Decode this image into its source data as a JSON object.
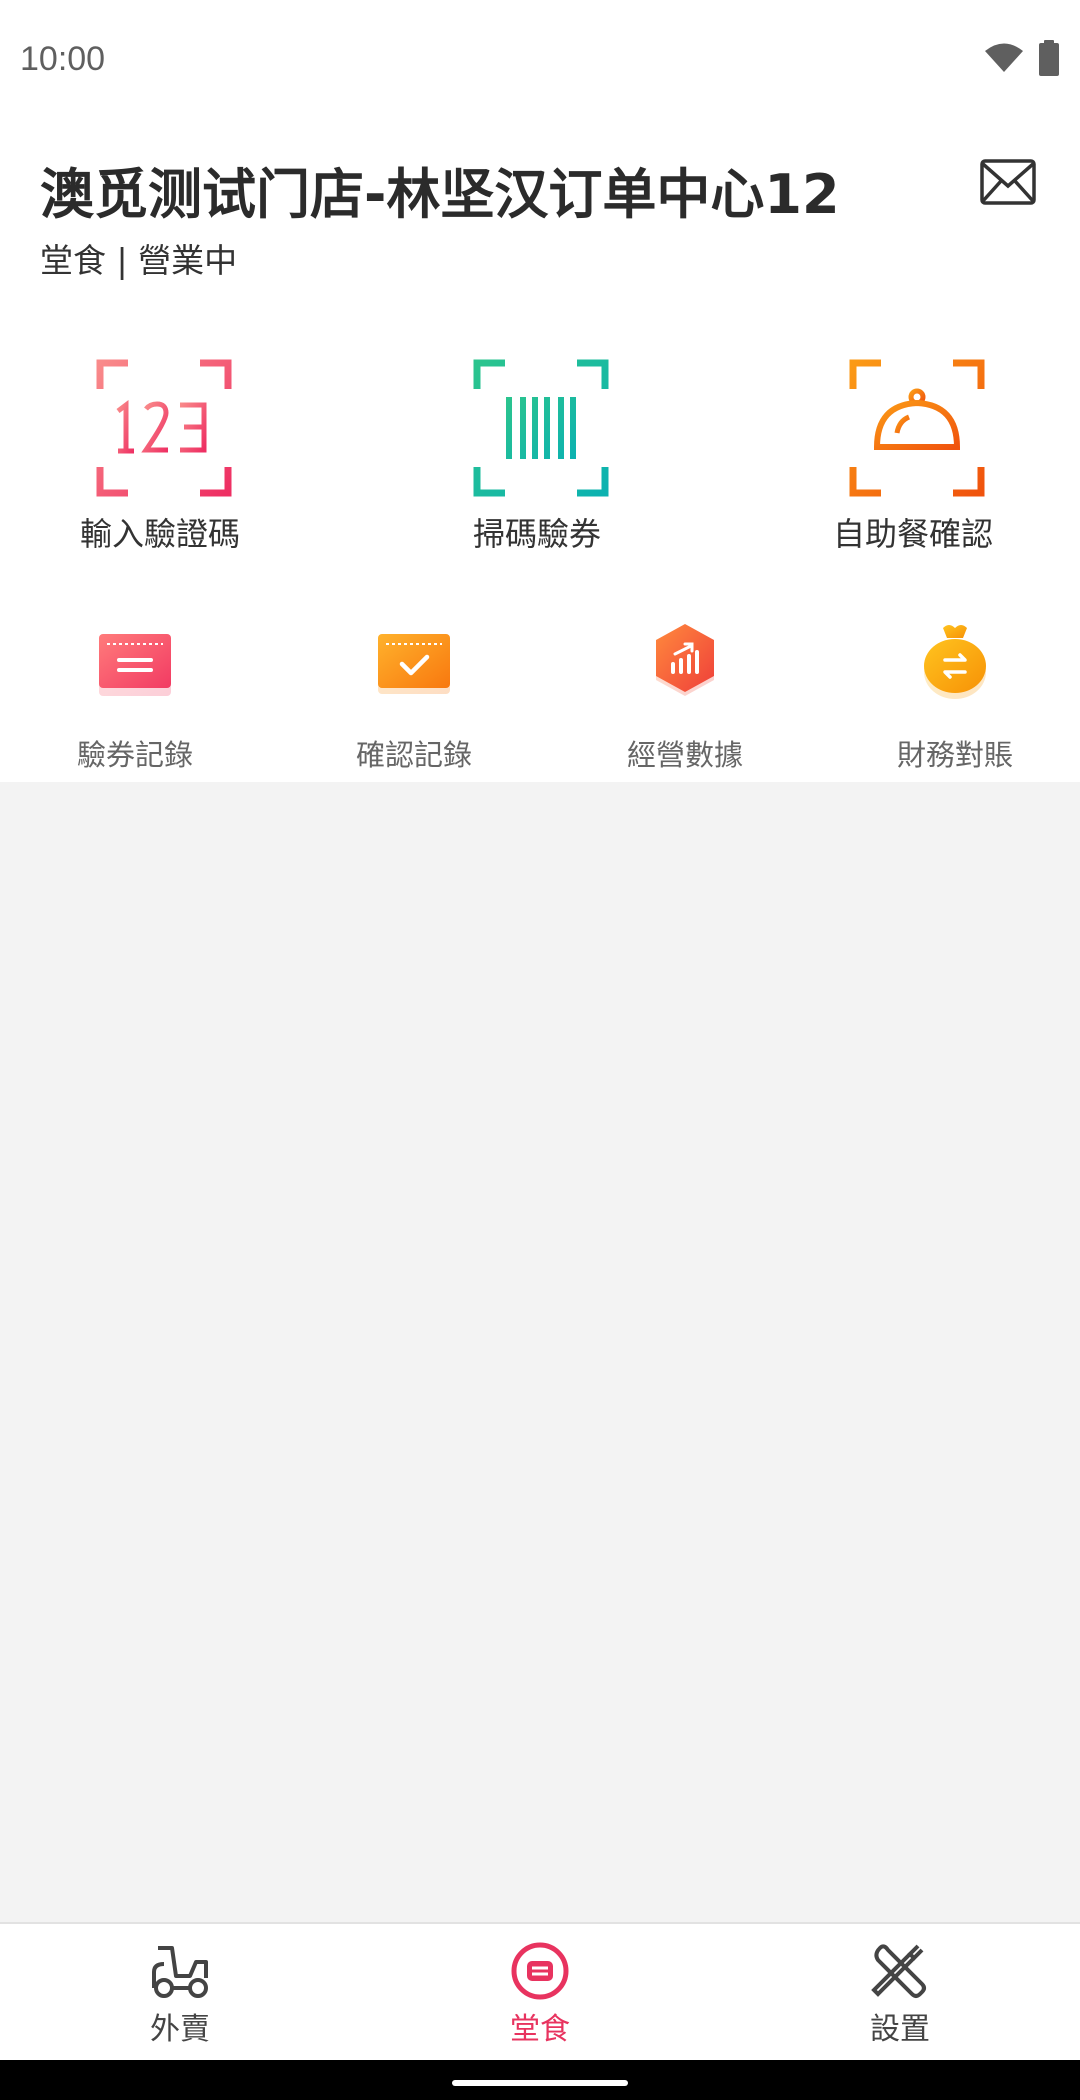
{
  "status_bar": {
    "time": "10:00",
    "wifi_icon": "wifi-icon",
    "battery_icon": "battery-icon"
  },
  "header": {
    "title": "澳觅测试门店-林坚汉订单中心12",
    "subtitle": "堂食 | 營業中",
    "mail_icon": "mail-icon"
  },
  "actions": [
    {
      "label": "輸入驗證碼",
      "icon": "code-input-icon",
      "color": "#ef4469"
    },
    {
      "label": "掃碼驗券",
      "icon": "barcode-scan-icon",
      "color": "#17b89a"
    },
    {
      "label": "自助餐確認",
      "icon": "food-cloche-icon",
      "color": "#f26a12"
    }
  ],
  "shortcuts": [
    {
      "label": "驗券記錄",
      "icon": "ticket-record-icon",
      "color": "#f8485e"
    },
    {
      "label": "確認記錄",
      "icon": "confirm-record-icon",
      "color": "#fa9418"
    },
    {
      "label": "經營數據",
      "icon": "business-data-icon",
      "color": "#f6553b"
    },
    {
      "label": "財務對賬",
      "icon": "money-bag-icon",
      "color": "#f7a511"
    }
  ],
  "bottom_nav": [
    {
      "label": "外賣",
      "icon": "scooter-icon",
      "active": false
    },
    {
      "label": "堂食",
      "icon": "dine-in-icon",
      "active": true
    },
    {
      "label": "設置",
      "icon": "tools-icon",
      "active": false
    }
  ],
  "colors": {
    "accent": "#e8335f",
    "background": "#f3f3f3",
    "surface": "#ffffff"
  }
}
